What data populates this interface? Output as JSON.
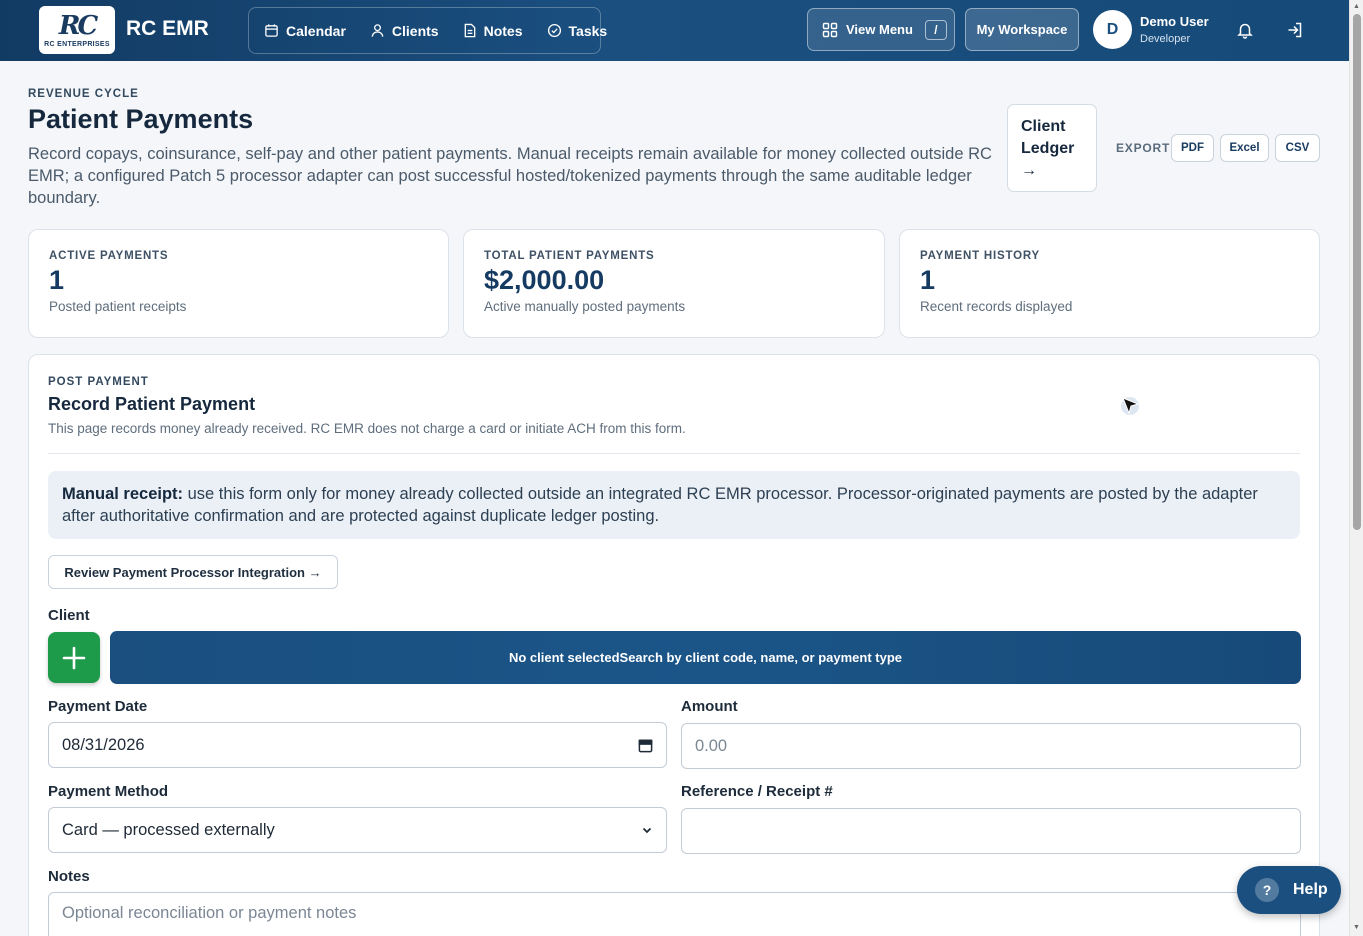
{
  "app": {
    "brand": "RC EMR",
    "logo_mark": "RC",
    "logo_sub": "RC ENTERPRISES"
  },
  "nav": {
    "items": [
      {
        "label": "Calendar",
        "icon": "calendar-icon"
      },
      {
        "label": "Clients",
        "icon": "user-icon"
      },
      {
        "label": "Notes",
        "icon": "document-icon"
      },
      {
        "label": "Tasks",
        "icon": "check-circle-icon"
      }
    ],
    "view_menu": "View Menu",
    "view_menu_shortcut": "/",
    "workspace": "My Workspace"
  },
  "user": {
    "initial": "D",
    "name": "Demo User",
    "role": "Developer"
  },
  "header": {
    "eyebrow": "REVENUE CYCLE",
    "title": "Patient Payments",
    "description": "Record copays, coinsurance, self-pay and other patient payments. Manual receipts remain available for money collected outside RC EMR; a configured Patch 5 processor adapter can post successful hosted/tokenized payments through the same auditable ledger boundary.",
    "ledger_button": "Client Ledger →",
    "export_label": "EXPORT",
    "export_buttons": [
      "PDF",
      "Excel",
      "CSV"
    ]
  },
  "stats": [
    {
      "label": "ACTIVE PAYMENTS",
      "value": "1",
      "caption": "Posted patient receipts"
    },
    {
      "label": "TOTAL PATIENT PAYMENTS",
      "value": "$2,000.00",
      "caption": "Active manually posted payments"
    },
    {
      "label": "PAYMENT HISTORY",
      "value": "1",
      "caption": "Recent records displayed"
    }
  ],
  "form": {
    "eyebrow": "POST PAYMENT",
    "title": "Record Patient Payment",
    "subtitle": "This page records money already received. RC EMR does not charge a card or initiate ACH from this form.",
    "notice_bold": "Manual receipt:",
    "notice_text": " use this form only for money already collected outside an integrated RC EMR processor. Processor-originated payments are posted by the adapter after authoritative confirmation and are protected against duplicate ledger posting.",
    "review_button": "Review Payment Processor Integration →",
    "client_label": "Client",
    "client_select_text": "No client selectedSearch by client code, name, or payment type",
    "payment_date_label": "Payment Date",
    "payment_date_value": "08/31/2026",
    "amount_label": "Amount",
    "amount_placeholder": "0.00",
    "method_label": "Payment Method",
    "method_value": "Card — processed externally",
    "reference_label": "Reference / Receipt #",
    "reference_value": "",
    "notes_label": "Notes",
    "notes_placeholder": "Optional reconciliation or payment notes"
  },
  "help": {
    "icon": "?",
    "label": "Help"
  },
  "colors": {
    "primary": "#1a4f80",
    "success": "#1e9a4b",
    "page_bg": "#f4f6f9"
  }
}
